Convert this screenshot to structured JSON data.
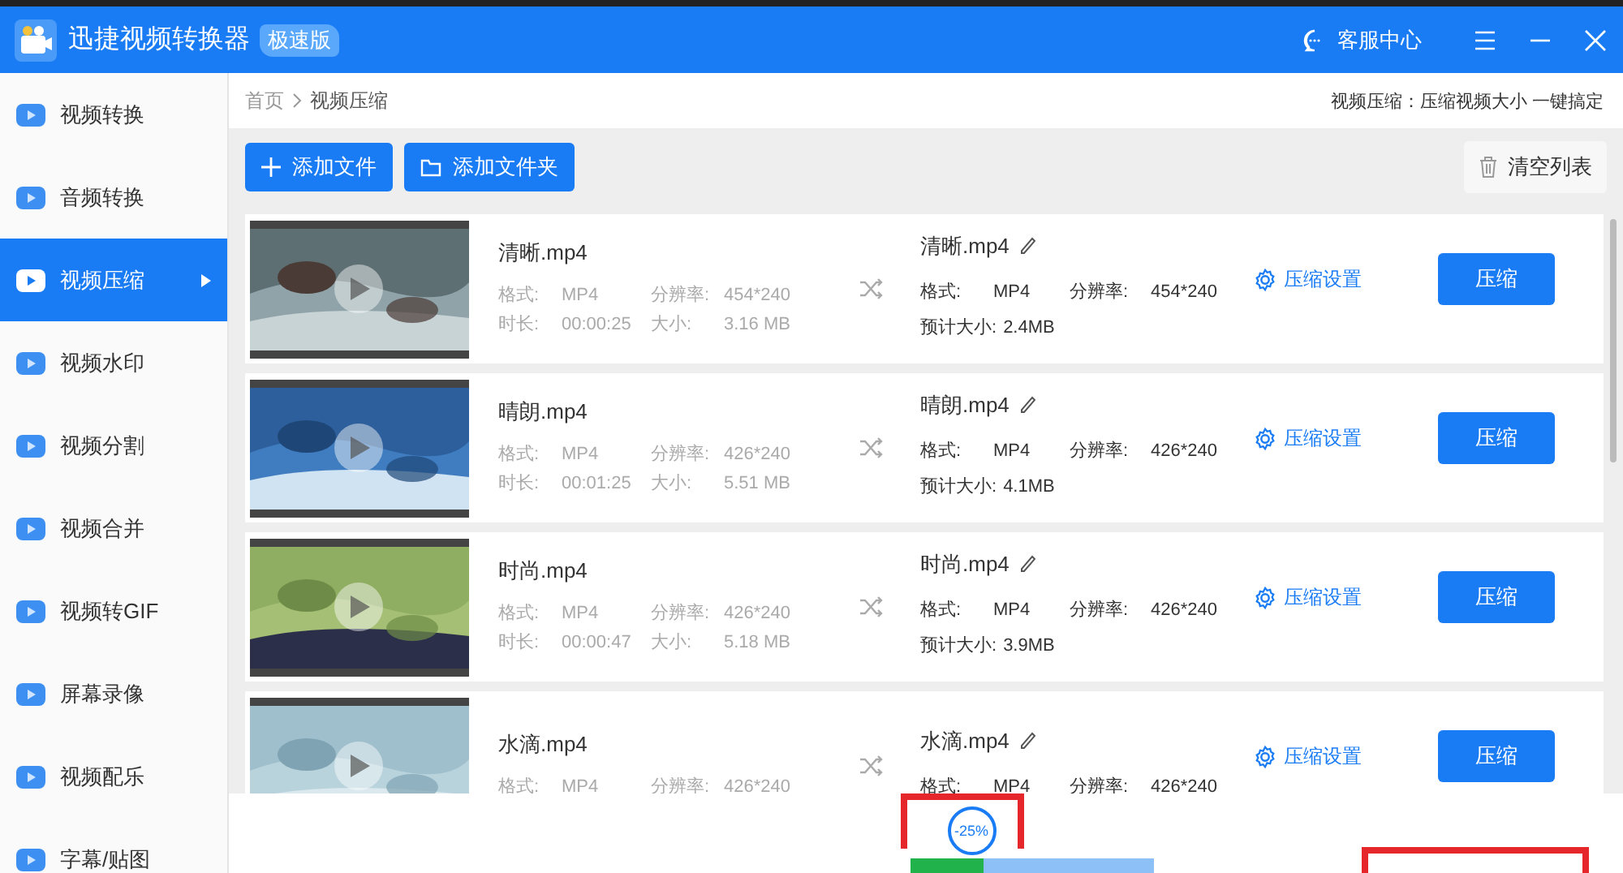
{
  "window": {
    "title": "迅捷视频转换器",
    "badge": "极速版",
    "support": "客服中心"
  },
  "sidebar": {
    "items": [
      {
        "label": "视频转换",
        "selected": false
      },
      {
        "label": "音频转换",
        "selected": false
      },
      {
        "label": "视频压缩",
        "selected": true
      },
      {
        "label": "视频水印",
        "selected": false
      },
      {
        "label": "视频分割",
        "selected": false
      },
      {
        "label": "视频合并",
        "selected": false
      },
      {
        "label": "视频转GIF",
        "selected": false
      },
      {
        "label": "屏幕录像",
        "selected": false
      },
      {
        "label": "视频配乐",
        "selected": false
      },
      {
        "label": "字幕/贴图",
        "selected": false
      }
    ]
  },
  "breadcrumb": [
    "首页",
    "视频压缩"
  ],
  "tagline": "视频压缩：压缩视频大小 一键搞定",
  "toolbar": {
    "add_file": "添加文件",
    "add_folder": "添加文件夹",
    "clear": "清空列表"
  },
  "files": [
    {
      "name": "清晰.mp4",
      "format_label": "格式:",
      "format": "MP4",
      "resolution_label": "分辨率:",
      "resolution": "454*240",
      "duration_label": "时长:",
      "duration": "00:00:25",
      "size_label": "大小:",
      "size": "3.16 MB",
      "output": {
        "name": "清晰.mp4",
        "format_label": "格式:",
        "format": "MP4",
        "resolution_label": "分辨率:",
        "resolution": "454*240",
        "estimate_label": "预计大小:",
        "estimate": "2.4MB"
      },
      "settings": "压缩设置",
      "action": "压缩"
    },
    {
      "name": "晴朗.mp4",
      "format_label": "格式:",
      "format": "MP4",
      "resolution_label": "分辨率:",
      "resolution": "426*240",
      "duration_label": "时长:",
      "duration": "00:01:25",
      "size_label": "大小:",
      "size": "5.51 MB",
      "output": {
        "name": "晴朗.mp4",
        "format_label": "格式:",
        "format": "MP4",
        "resolution_label": "分辨率:",
        "resolution": "426*240",
        "estimate_label": "预计大小:",
        "estimate": "4.1MB"
      },
      "settings": "压缩设置",
      "action": "压缩"
    },
    {
      "name": "时尚.mp4",
      "format_label": "格式:",
      "format": "MP4",
      "resolution_label": "分辨率:",
      "resolution": "426*240",
      "duration_label": "时长:",
      "duration": "00:00:47",
      "size_label": "大小:",
      "size": "5.18 MB",
      "output": {
        "name": "时尚.mp4",
        "format_label": "格式:",
        "format": "MP4",
        "resolution_label": "分辨率:",
        "resolution": "426*240",
        "estimate_label": "预计大小:",
        "estimate": "3.9MB"
      },
      "settings": "压缩设置",
      "action": "压缩"
    },
    {
      "name": "水滴.mp4",
      "format_label": "格式:",
      "format": "MP4",
      "resolution_label": "分辨率:",
      "resolution": "426*240",
      "output": {
        "name": "水滴.mp4",
        "format_label": "格式:",
        "format": "MP4",
        "resolution_label": "分辨率:",
        "resolution": "426*240"
      },
      "settings": "压缩设置",
      "action": "压缩"
    }
  ],
  "compression": {
    "level": 0.3,
    "reading": "-25%"
  }
}
